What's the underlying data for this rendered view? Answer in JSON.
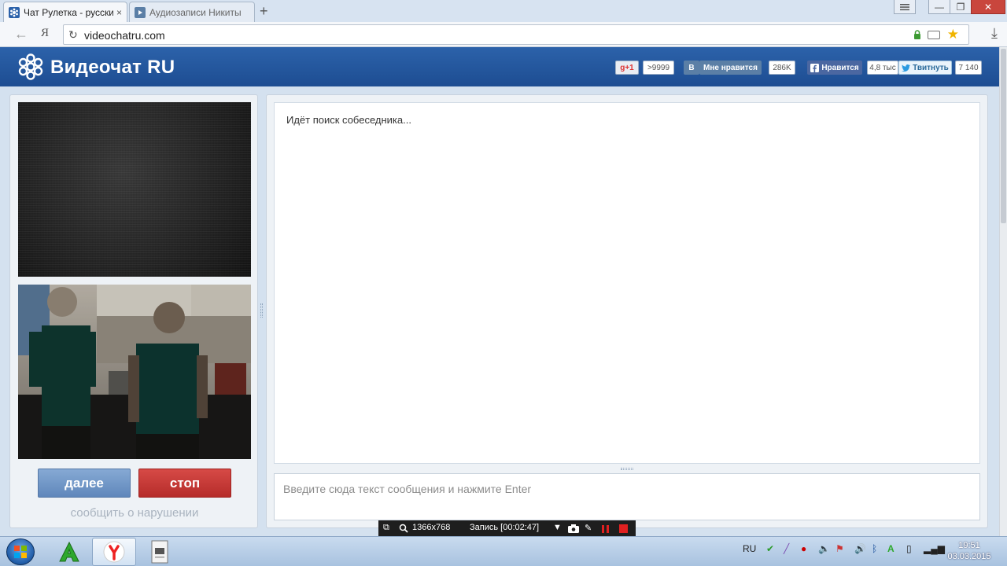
{
  "browser": {
    "tabs": [
      {
        "label": "Чат Рулетка - русский",
        "close": "×"
      },
      {
        "label": "Аудиозаписи Никиты"
      }
    ],
    "new_tab": "+",
    "back": "←",
    "yandex": "Я",
    "url": "videochatru.com",
    "window_controls": {
      "minimize": "—",
      "restore": "❐",
      "close": "✕"
    }
  },
  "site": {
    "logo": "Видеочат RU",
    "social": {
      "gplus_label": "g+1",
      "gplus_count": ">9999",
      "vk_label": "B",
      "vk_like": "Мне нравится",
      "vk_count": "286K",
      "fb_label": "Нравится",
      "fb_count": "4,8 тыс",
      "tw_label": "Твитнуть",
      "tw_count": "7 140"
    },
    "buttons": {
      "next": "далее",
      "stop": "стоп"
    },
    "report_link": "сообщить о нарушении",
    "chat_status": "Идёт поиск собеседника...",
    "chat_placeholder": "Введите сюда текст сообщения и нажмите Enter"
  },
  "recorder": {
    "resolution": "1366x768",
    "recording": "Запись [00:02:47]"
  },
  "taskbar": {
    "language": "RU",
    "time": "19:51",
    "date": "03.03.2015"
  },
  "colors": {
    "header_blue": "#2c62aa",
    "next_button": "#6f95c6",
    "stop_button": "#c73a37",
    "twitter_blue": "#2a6a9a"
  }
}
